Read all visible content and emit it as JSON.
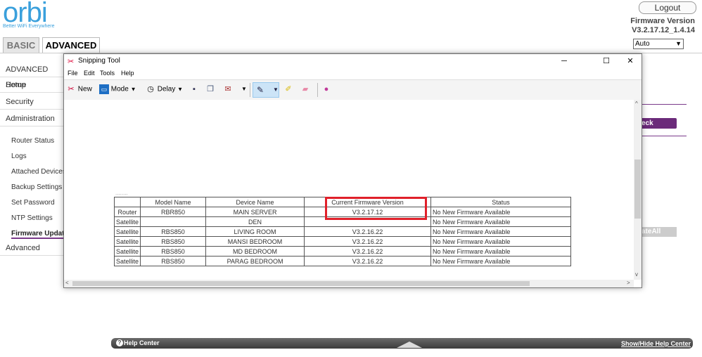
{
  "brand": {
    "logo": "orbi",
    "tagline": "Better WiFi Everywhere"
  },
  "tabs": [
    {
      "label": "BASIC"
    },
    {
      "label": "ADVANCED"
    }
  ],
  "header": {
    "logout_label": "Logout",
    "firmware_label": "Firmware Version",
    "firmware_value": "V3.2.17.12_1.4.14",
    "language_select": "Auto"
  },
  "sidebar": {
    "items": [
      {
        "label": "ADVANCED Home"
      },
      {
        "label": "Setup"
      },
      {
        "label": "Security"
      },
      {
        "label": "Administration"
      }
    ],
    "sub_items": [
      {
        "label": "Router Status"
      },
      {
        "label": "Logs"
      },
      {
        "label": "Attached Devices"
      },
      {
        "label": "Backup Settings"
      },
      {
        "label": "Set Password"
      },
      {
        "label": "NTP Settings"
      },
      {
        "label": "Firmware Update"
      }
    ],
    "bottom_item": "Advanced"
  },
  "background_buttons": {
    "check_label": "eck",
    "update_all_label": "ateAll"
  },
  "snipping_tool": {
    "title": "Snipping Tool",
    "menu": [
      "File",
      "Edit",
      "Tools",
      "Help"
    ],
    "toolbar": {
      "new_label": "New",
      "mode_label": "Mode",
      "delay_label": "Delay"
    }
  },
  "firmware_table": {
    "columns": [
      "",
      "Model Name",
      "Device Name",
      "Current Firmware Version",
      "Status"
    ],
    "rows": [
      [
        "Router",
        "RBR850",
        "MAIN SERVER",
        "V3.2.17.12",
        "No New Firmware Available"
      ],
      [
        "Satellite",
        "",
        "DEN",
        "",
        "No New Firmware Available"
      ],
      [
        "Satellite",
        "RBS850",
        "LIVING ROOM",
        "V3.2.16.22",
        "No New Firmware Available"
      ],
      [
        "Satellite",
        "RBS850",
        "MANSI BEDROOM",
        "V3.2.16.22",
        "No New Firmware Available"
      ],
      [
        "Satellite",
        "RBS850",
        "MD BEDROOM",
        "V3.2.16.22",
        "No New Firmware Available"
      ],
      [
        "Satellite",
        "RBS850",
        "PARAG BEDROOM",
        "V3.2.16.22",
        "No New Firmware Available"
      ]
    ]
  },
  "help_bar": {
    "left_label": "Help Center",
    "right_label": "Show/Hide Help Center"
  },
  "colors": {
    "accent": "#6b2b7a",
    "brand": "#3aa0dc",
    "highlight": "#e0202a"
  }
}
